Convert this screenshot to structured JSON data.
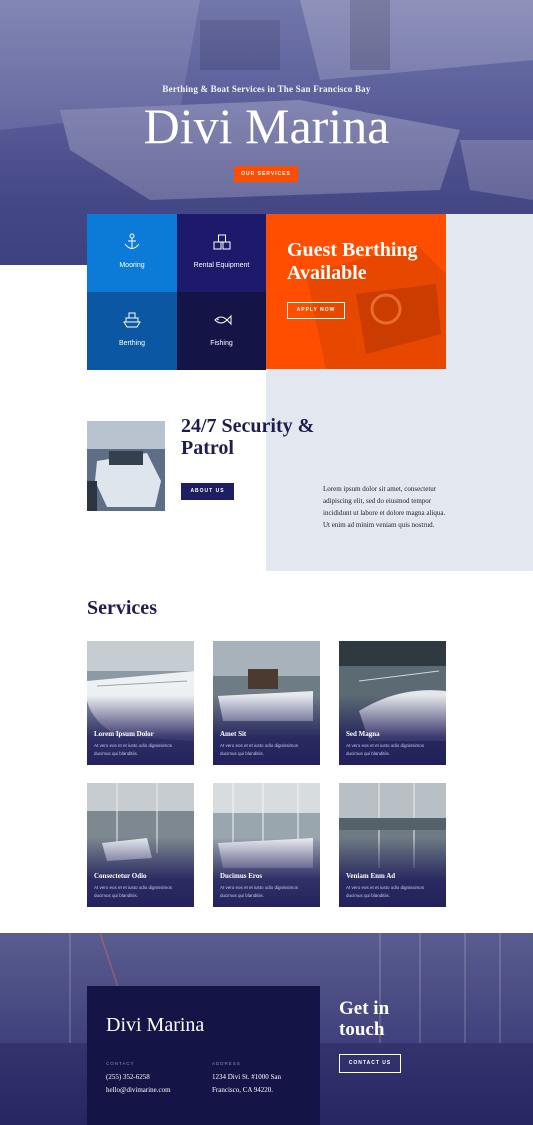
{
  "hero": {
    "subtitle": "Berthing & Boat Services in The San Francisco Bay",
    "title": "Divi Marina",
    "button_label": "OUR SERVICES"
  },
  "tiles": [
    {
      "label": "Mooring",
      "icon": "anchor-icon",
      "color": "#0c7bd8"
    },
    {
      "label": "Rental Equipment",
      "icon": "boxes-icon",
      "color": "#1e1a6b"
    },
    {
      "label": "Berthing",
      "icon": "ship-icon",
      "color": "#0c57a3"
    },
    {
      "label": "Fishing",
      "icon": "fish-icon",
      "color": "#151447"
    }
  ],
  "berthing_card": {
    "title": "Guest Berthing Available",
    "button_label": "APPLY NOW"
  },
  "security": {
    "title": "24/7 Security & Patrol",
    "button_label": "ABOUT US",
    "text": "Lorem ipsum dolor sit amet, consectetur adipiscing elit, sed do eiusmod tempor incididunt ut labore et dolore magna aliqua. Ut enim ad minim veniam quis nostrud."
  },
  "services": {
    "heading": "Services",
    "items": [
      {
        "title": "Lorem Ipsum Dolor",
        "desc": "At vero eos et et iusto odio dignissimos ducimus qui blanditiis."
      },
      {
        "title": "Amet Sit",
        "desc": "At vero eos et et iusto odio dignissimos ducimus qui blanditiis."
      },
      {
        "title": "Sed Magna",
        "desc": "At vero eos et et iusto odio dignissimos ducimus qui blanditiis."
      },
      {
        "title": "Consectetur Odio",
        "desc": "At vero eos et et iusto odio dignissimos ducimus qui blanditiis."
      },
      {
        "title": "Ducimus Eros",
        "desc": "At vero eos et et iusto odio dignissimos ducimus qui blanditiis."
      },
      {
        "title": "Veniam Enm Ad",
        "desc": "At vero eos et et iusto odio dignissimos ducimus qui blanditiis."
      }
    ]
  },
  "footer": {
    "brand": "Divi Marina",
    "contact_label": "CONTACT",
    "phone": "(255) 352-6258",
    "email": "hello@divimarine.com",
    "address_label": "ADDRESS",
    "address_line1": "1234 Divi St. #1000 San",
    "address_line2": "Francisco, CA 94220.",
    "get_in_touch": "Get in touch",
    "button_label": "CONTACT US"
  },
  "colors": {
    "accent": "#ff4e00",
    "navy": "#1e1d52",
    "panel": "#e3e7f0"
  }
}
